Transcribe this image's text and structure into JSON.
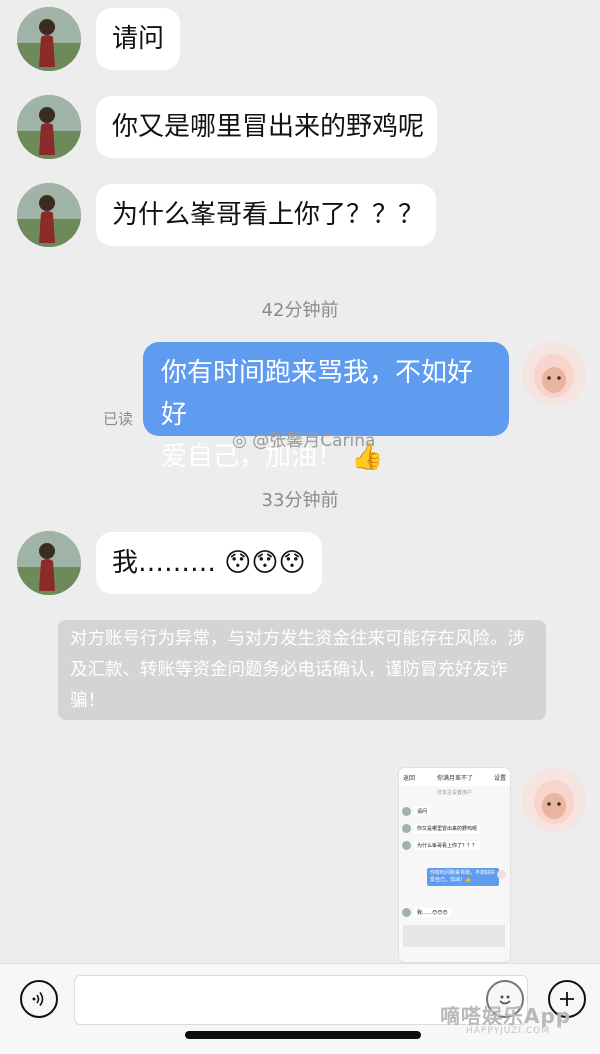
{
  "messages": {
    "m1": "请问",
    "m2": "你又是哪里冒出来的野鸡呢",
    "m3": "为什么峯哥看上你了？？？",
    "m4_line1": "你有时间跑来骂我，不如好好",
    "m4_line2": "爱自己，加油！",
    "m4_emoji": "👍",
    "m5": "我………",
    "m5_emoji": "😯😯😯"
  },
  "timestamps": {
    "t1": "42分钟前",
    "t2": "33分钟前"
  },
  "read_label": "已读",
  "weibo_watermark": "@张馨月Carina",
  "warning_text": "对方账号行为异常，与对方发生资金往来可能存在风险。涉及汇款、转账等资金问题务必电话确认，谨防冒充好友诈骗！",
  "screenshot_thumbnail": {
    "header": "你满月差不了",
    "back": "返回",
    "settings": "设置",
    "subheader": "非本主设置用户",
    "msgs": [
      "请问",
      "你又是哪里冒出来的野鸡呢",
      "为什么峯哥看上你了？？？",
      "你有时间跑来骂我，不如好好爱自己，加油！👍",
      "我……😯😯😯"
    ]
  },
  "watermark_site": {
    "text": "嘀嗒娱乐App",
    "url": "HAPPYJUZI.COM"
  },
  "colors": {
    "background": "#ededed",
    "outgoing_bubble": "#5f9cf0",
    "incoming_bubble": "#ffffff",
    "warning_bg": "#d4d4d4"
  },
  "icons": {
    "voice": "voice-icon",
    "emoji": "emoji-icon",
    "plus": "plus-icon"
  }
}
